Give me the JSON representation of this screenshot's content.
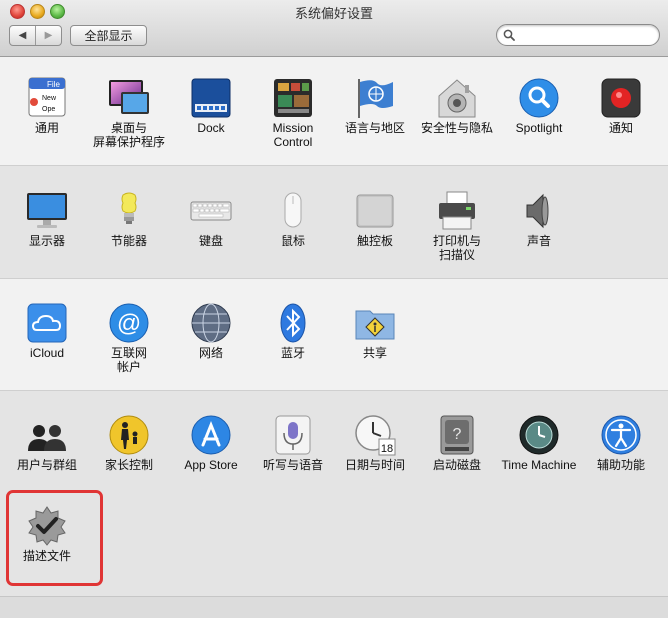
{
  "window": {
    "title": "系统偏好设置"
  },
  "toolbar": {
    "back_label": "◀",
    "forward_label": "▶",
    "show_all_label": "全部显示",
    "search_placeholder": ""
  },
  "colors": {
    "highlight_border": "#e03535"
  },
  "sections": [
    {
      "panes": [
        {
          "label": "通用",
          "icon": "general-icon"
        },
        {
          "label": "桌面与\n屏幕保护程序",
          "icon": "desktop-screensaver-icon"
        },
        {
          "label": "Dock",
          "icon": "dock-icon"
        },
        {
          "label": "Mission\nControl",
          "icon": "mission-control-icon"
        },
        {
          "label": "语言与地区",
          "icon": "language-region-icon"
        },
        {
          "label": "安全性与隐私",
          "icon": "security-privacy-icon"
        },
        {
          "label": "Spotlight",
          "icon": "spotlight-icon"
        },
        {
          "label": "通知",
          "icon": "notifications-icon"
        }
      ]
    },
    {
      "panes": [
        {
          "label": "显示器",
          "icon": "display-icon"
        },
        {
          "label": "节能器",
          "icon": "energy-saver-icon"
        },
        {
          "label": "键盘",
          "icon": "keyboard-icon"
        },
        {
          "label": "鼠标",
          "icon": "mouse-icon"
        },
        {
          "label": "触控板",
          "icon": "trackpad-icon"
        },
        {
          "label": "打印机与\n扫描仪",
          "icon": "printer-scanner-icon"
        },
        {
          "label": "声音",
          "icon": "sound-icon"
        }
      ]
    },
    {
      "panes": [
        {
          "label": "iCloud",
          "icon": "icloud-icon"
        },
        {
          "label": "互联网\n帐户",
          "icon": "internet-accounts-icon"
        },
        {
          "label": "网络",
          "icon": "network-icon"
        },
        {
          "label": "蓝牙",
          "icon": "bluetooth-icon"
        },
        {
          "label": "共享",
          "icon": "sharing-icon"
        }
      ]
    },
    {
      "panes": [
        {
          "label": "用户与群组",
          "icon": "users-groups-icon"
        },
        {
          "label": "家长控制",
          "icon": "parental-controls-icon"
        },
        {
          "label": "App Store",
          "icon": "app-store-icon"
        },
        {
          "label": "听写与语音",
          "icon": "dictation-speech-icon"
        },
        {
          "label": "日期与时间",
          "icon": "date-time-icon"
        },
        {
          "label": "启动磁盘",
          "icon": "startup-disk-icon"
        },
        {
          "label": "Time Machine",
          "icon": "time-machine-icon"
        },
        {
          "label": "辅助功能",
          "icon": "accessibility-icon"
        }
      ]
    },
    {
      "panes": [
        {
          "label": "描述文件",
          "icon": "profiles-icon"
        }
      ]
    }
  ],
  "icon_text": {
    "general_file": "File",
    "general_new": "New",
    "general_open": "Ope",
    "calendar_day": "18"
  }
}
